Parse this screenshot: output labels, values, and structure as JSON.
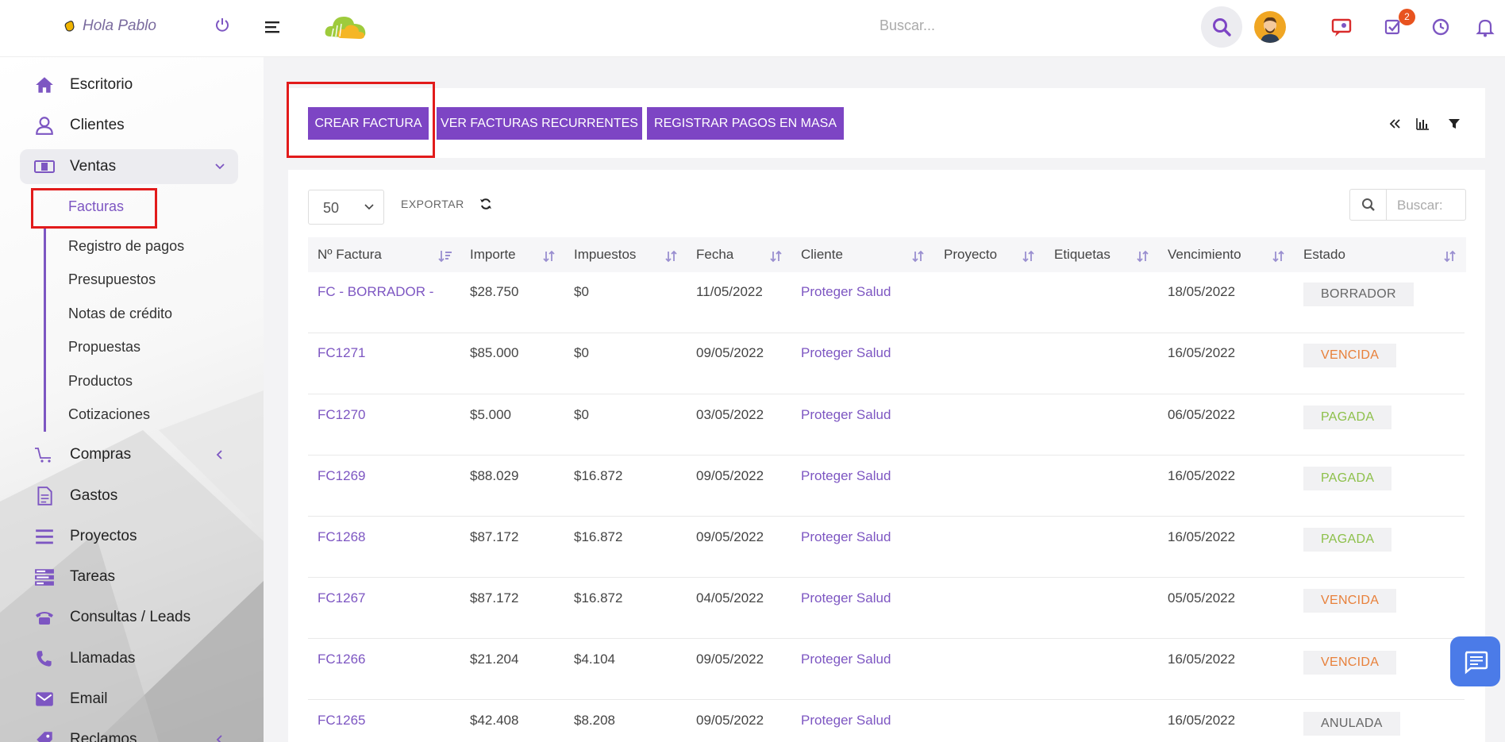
{
  "header": {
    "greeting": "Hola Pablo",
    "search_placeholder": "Buscar...",
    "tasks_badge": "2"
  },
  "sidebar": {
    "items": [
      {
        "label": "Escritorio",
        "icon": "home-icon"
      },
      {
        "label": "Clientes",
        "icon": "user-icon"
      },
      {
        "label": "Ventas",
        "icon": "money-icon"
      },
      {
        "label": "Compras",
        "icon": "cart-icon"
      },
      {
        "label": "Gastos",
        "icon": "document-icon"
      },
      {
        "label": "Proyectos",
        "icon": "bars-icon"
      },
      {
        "label": "Tareas",
        "icon": "tasks-icon"
      },
      {
        "label": "Consultas / Leads",
        "icon": "phone-desk-icon"
      },
      {
        "label": "Llamadas",
        "icon": "phone-call-icon"
      },
      {
        "label": "Email",
        "icon": "email-icon"
      },
      {
        "label": "Reclamos",
        "icon": "tag-icon"
      }
    ],
    "ventas_sub": [
      "Facturas",
      "Registro de pagos",
      "Presupuestos",
      "Notas de crédito",
      "Propuestas",
      "Productos",
      "Cotizaciones"
    ]
  },
  "toolbar": {
    "create": "CREAR FACTURA",
    "recurring": "VER FACTURAS RECURRENTES",
    "bulk_pay": "REGISTRAR PAGOS EN MASA"
  },
  "table": {
    "page_size": "50",
    "export": "EXPORTAR",
    "search_placeholder": "Buscar:",
    "columns": [
      "Nº Factura",
      "Importe",
      "Impuestos",
      "Fecha",
      "Cliente",
      "Proyecto",
      "Etiquetas",
      "Vencimiento",
      "Estado"
    ],
    "rows": [
      {
        "num": "FC - BORRADOR -",
        "importe": "$28.750",
        "impuestos": "$0",
        "fecha": "11/05/2022",
        "cliente": "Proteger Salud",
        "venc": "18/05/2022",
        "estado": "BORRADOR",
        "st": "borrador"
      },
      {
        "num": "FC1271",
        "importe": "$85.000",
        "impuestos": "$0",
        "fecha": "09/05/2022",
        "cliente": "Proteger Salud",
        "venc": "16/05/2022",
        "estado": "VENCIDA",
        "st": "vencida"
      },
      {
        "num": "FC1270",
        "importe": "$5.000",
        "impuestos": "$0",
        "fecha": "03/05/2022",
        "cliente": "Proteger Salud",
        "venc": "06/05/2022",
        "estado": "PAGADA",
        "st": "pagada"
      },
      {
        "num": "FC1269",
        "importe": "$88.029",
        "impuestos": "$16.872",
        "fecha": "09/05/2022",
        "cliente": "Proteger Salud",
        "venc": "16/05/2022",
        "estado": "PAGADA",
        "st": "pagada"
      },
      {
        "num": "FC1268",
        "importe": "$87.172",
        "impuestos": "$16.872",
        "fecha": "09/05/2022",
        "cliente": "Proteger Salud",
        "venc": "16/05/2022",
        "estado": "PAGADA",
        "st": "pagada"
      },
      {
        "num": "FC1267",
        "importe": "$87.172",
        "impuestos": "$16.872",
        "fecha": "04/05/2022",
        "cliente": "Proteger Salud",
        "venc": "05/05/2022",
        "estado": "VENCIDA",
        "st": "vencida"
      },
      {
        "num": "FC1266",
        "importe": "$21.204",
        "impuestos": "$4.104",
        "fecha": "09/05/2022",
        "cliente": "Proteger Salud",
        "venc": "16/05/2022",
        "estado": "VENCIDA",
        "st": "vencida"
      },
      {
        "num": "FC1265",
        "importe": "$42.408",
        "impuestos": "$8.208",
        "fecha": "09/05/2022",
        "cliente": "Proteger Salud",
        "venc": "16/05/2022",
        "estado": "ANULADA",
        "st": "anulada"
      }
    ]
  },
  "colors": {
    "accent": "#7d45c4",
    "link": "#7d56c2",
    "vencida": "#e8803a",
    "pagada": "#8dc04a",
    "highlight": "#e21b1b"
  }
}
